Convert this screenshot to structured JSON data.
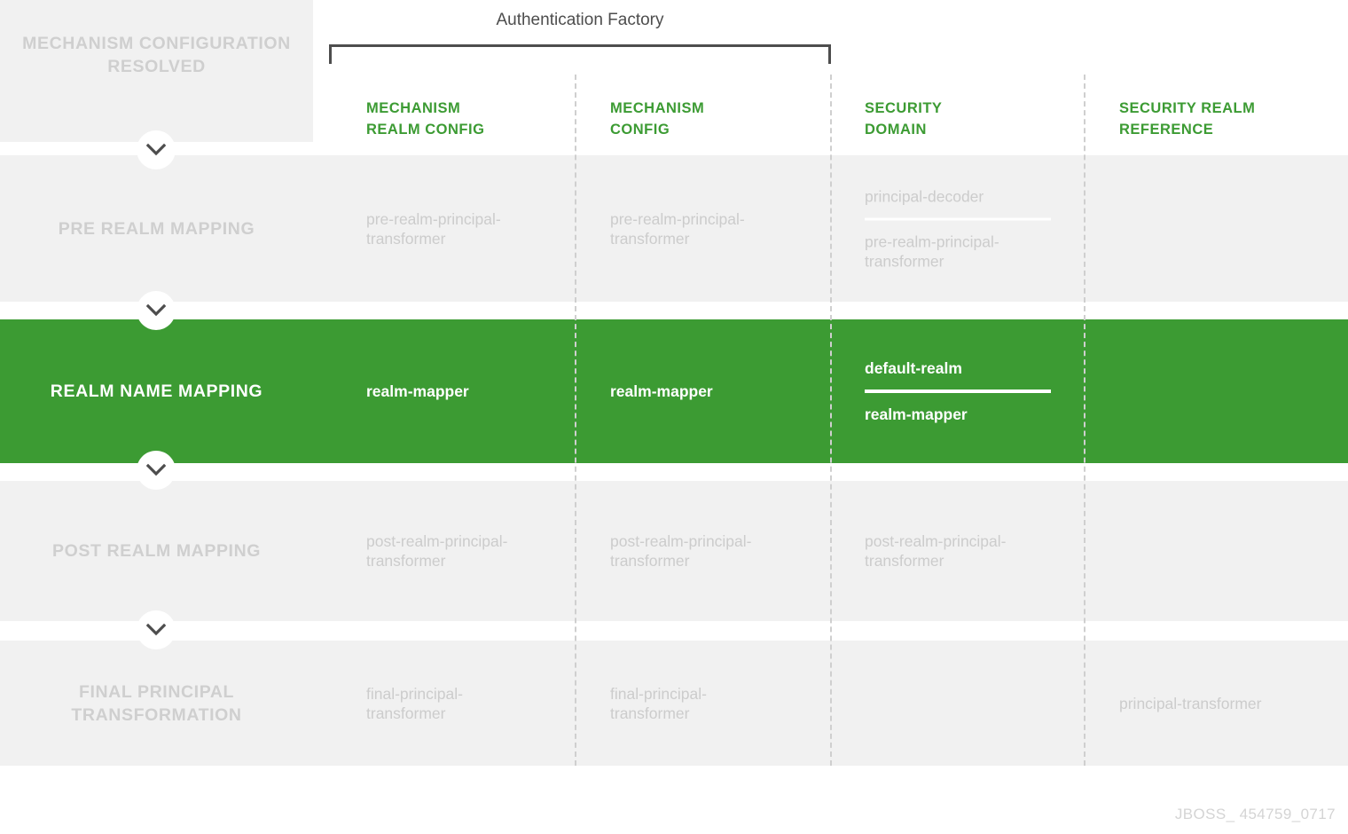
{
  "diagram": {
    "factory_title": "Authentication Factory",
    "watermark": "JBOSS_ 454759_0717",
    "accent_green": "#3c9b33",
    "row_grey": "#f1f1f1",
    "muted_text": "#cccccc",
    "dash_color": "#cfcfcf",
    "bracket_color": "#4d4d4d"
  },
  "columns": [
    {
      "id": "mechanism-realm-config",
      "label": "MECHANISM\nREALM CONFIG"
    },
    {
      "id": "mechanism-config",
      "label": "MECHANISM\nCONFIG"
    },
    {
      "id": "security-domain",
      "label": "SECURITY\nDOMAIN"
    },
    {
      "id": "security-realm-reference",
      "label": "SECURITY REALM\nREFERENCE"
    }
  ],
  "stage_header": {
    "label": "MECHANISM\nCONFIGURATION\nRESOLVED"
  },
  "rows": [
    {
      "id": "pre-realm-mapping",
      "label": "PRE REALM\nMAPPING",
      "highlight": false,
      "cells": {
        "mechanism_realm_config": "pre-realm-principal-\ntransformer",
        "mechanism_config": "pre-realm-principal-\ntransformer",
        "security_domain_top": "principal-decoder",
        "security_domain_bottom": "pre-realm-principal-\ntransformer",
        "security_realm_reference": ""
      }
    },
    {
      "id": "realm-name-mapping",
      "label": "REALM NAME\nMAPPING",
      "highlight": true,
      "cells": {
        "mechanism_realm_config": "realm-mapper",
        "mechanism_config": "realm-mapper",
        "security_domain_top": "default-realm",
        "security_domain_bottom": "realm-mapper",
        "security_realm_reference": ""
      }
    },
    {
      "id": "post-realm-mapping",
      "label": "POST REALM\nMAPPING",
      "highlight": false,
      "cells": {
        "mechanism_realm_config": "post-realm-principal-\ntransformer",
        "mechanism_config": "post-realm-principal-\ntransformer",
        "security_domain_top": "post-realm-principal-\ntransformer",
        "security_domain_bottom": "",
        "security_realm_reference": ""
      }
    },
    {
      "id": "final-principal-transformation",
      "label": "FINAL PRINCIPAL\nTRANSFORMATION",
      "highlight": false,
      "cells": {
        "mechanism_realm_config": "final-principal-\ntransformer",
        "mechanism_config": "final-principal-\ntransformer",
        "security_domain_top": "",
        "security_domain_bottom": "",
        "security_realm_reference": "principal-transformer"
      }
    }
  ],
  "chevrons": [
    {
      "id": "chevron-1"
    },
    {
      "id": "chevron-2"
    },
    {
      "id": "chevron-3"
    },
    {
      "id": "chevron-4"
    }
  ]
}
